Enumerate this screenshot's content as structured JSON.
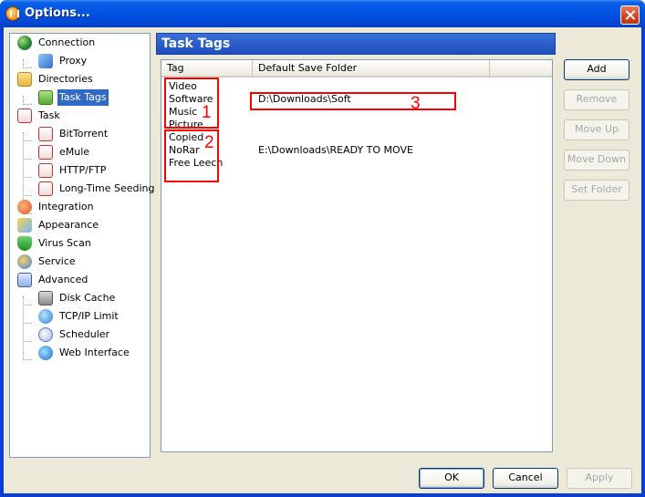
{
  "window": {
    "title": "Options..."
  },
  "tree": {
    "items": [
      {
        "label": "Connection",
        "icon": "connection-icon"
      },
      {
        "label": "Proxy",
        "icon": "proxy-icon"
      },
      {
        "label": "Directories",
        "icon": "folder-icon"
      },
      {
        "label": "Task Tags",
        "icon": "tag-icon",
        "selected": true
      },
      {
        "label": "Task",
        "icon": "task-icon"
      },
      {
        "label": "BitTorrent",
        "icon": "task-icon"
      },
      {
        "label": "eMule",
        "icon": "task-icon"
      },
      {
        "label": "HTTP/FTP",
        "icon": "task-icon"
      },
      {
        "label": "Long-Time Seeding",
        "icon": "task-icon"
      },
      {
        "label": "Integration",
        "icon": "integration-icon"
      },
      {
        "label": "Appearance",
        "icon": "appearance-icon"
      },
      {
        "label": "Virus Scan",
        "icon": "shield-icon"
      },
      {
        "label": "Service",
        "icon": "service-icon"
      },
      {
        "label": "Advanced",
        "icon": "advanced-icon"
      },
      {
        "label": "Disk Cache",
        "icon": "disk-icon"
      },
      {
        "label": "TCP/IP Limit",
        "icon": "network-icon"
      },
      {
        "label": "Scheduler",
        "icon": "clock-icon"
      },
      {
        "label": "Web Interface",
        "icon": "globe-icon"
      }
    ]
  },
  "panel": {
    "title": "Task Tags"
  },
  "list": {
    "columns": [
      "Tag",
      "Default Save Folder"
    ],
    "rows": [
      {
        "tag": "Video",
        "folder": ""
      },
      {
        "tag": "Software",
        "folder": "D:\\Downloads\\Soft"
      },
      {
        "tag": "Music",
        "folder": ""
      },
      {
        "tag": "Picture",
        "folder": ""
      },
      {
        "tag": "Copied",
        "folder": ""
      },
      {
        "tag": "NoRar",
        "folder": "E:\\Downloads\\READY TO MOVE"
      },
      {
        "tag": "Free Leech",
        "folder": ""
      }
    ]
  },
  "side_buttons": {
    "add": "Add",
    "remove": "Remove",
    "move_up": "Move Up",
    "move_down": "Move Down",
    "set_folder": "Set Folder"
  },
  "annotations": {
    "box1": "1",
    "box2": "2",
    "box3": "3",
    "color": "#ff0000"
  },
  "footer": {
    "ok": "OK",
    "cancel": "Cancel",
    "apply": "Apply"
  },
  "colors": {
    "titlebar": "#0054e3",
    "selection": "#316ac5",
    "face": "#ece9d8"
  }
}
